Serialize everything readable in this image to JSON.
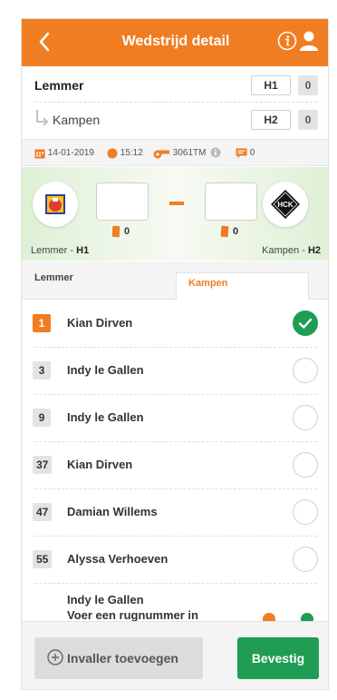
{
  "header": {
    "title": "Wedstrijd detail"
  },
  "teams": {
    "home": {
      "name": "Lemmer",
      "code": "H1",
      "score": "0"
    },
    "away": {
      "name": "Kampen",
      "code": "H2",
      "score": "0"
    }
  },
  "meta": {
    "date": "14-01-2019",
    "time": "15:12",
    "referee_code": "3061TM",
    "comments": "0"
  },
  "scoreboard": {
    "home_cards": "0",
    "away_cards": "0",
    "home_team": "Lemmer",
    "home_code": "H1",
    "away_team": "Kampen",
    "away_code": "H2",
    "away_logo_text": "HCK"
  },
  "tabs": [
    {
      "label": "Lemmer",
      "active": false
    },
    {
      "label": "Kampen",
      "active": true
    }
  ],
  "players": [
    {
      "number": "1",
      "name": "Kian Dirven",
      "selected": true
    },
    {
      "number": "3",
      "name": "Indy le Gallen",
      "selected": false
    },
    {
      "number": "9",
      "name": "Indy le Gallen",
      "selected": false
    },
    {
      "number": "37",
      "name": "Kian Dirven",
      "selected": false
    },
    {
      "number": "47",
      "name": "Damian Willems",
      "selected": false
    },
    {
      "number": "55",
      "name": "Alyssa Verhoeven",
      "selected": false
    }
  ],
  "extra_player": {
    "name": "Indy le Gallen",
    "hint": "Voer een rugnummer in"
  },
  "footer": {
    "add_sub_label": "Invaller toevoegen",
    "confirm_label": "Bevestig"
  },
  "colors": {
    "accent": "#f07d22",
    "success": "#1f9d55"
  }
}
